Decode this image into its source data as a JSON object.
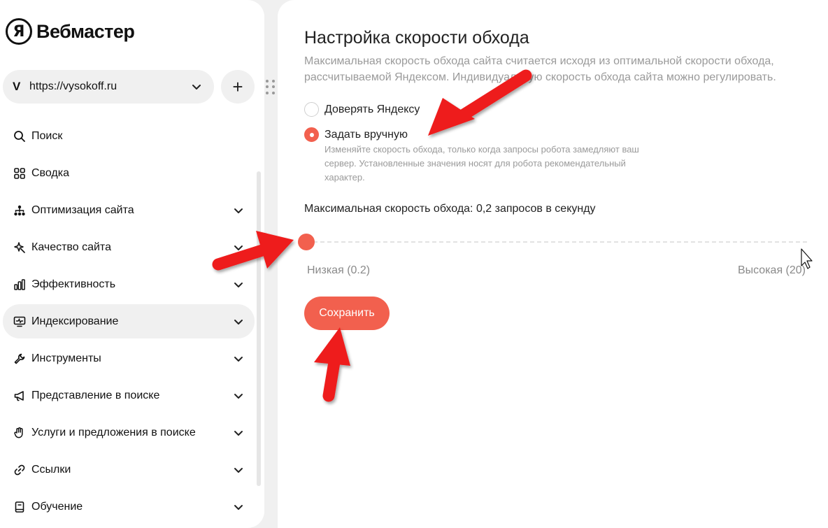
{
  "app": {
    "logo_mark": "Я",
    "title": "Вебмастер"
  },
  "site": {
    "favicon_letter": "V",
    "url": "https://vysokoff.ru",
    "add_label": "+"
  },
  "sidebar": {
    "items": [
      {
        "label": "Поиск",
        "icon": "search-icon",
        "chevron": false,
        "active": false
      },
      {
        "label": "Сводка",
        "icon": "grid-icon",
        "chevron": false,
        "active": false
      },
      {
        "label": "Оптимизация сайта",
        "icon": "sitemap-icon",
        "chevron": true,
        "active": false
      },
      {
        "label": "Качество сайта",
        "icon": "sparkle-icon",
        "chevron": true,
        "active": false
      },
      {
        "label": "Эффективность",
        "icon": "bar-chart-icon",
        "chevron": true,
        "active": false
      },
      {
        "label": "Индексирование",
        "icon": "monitor-icon",
        "chevron": true,
        "active": true
      },
      {
        "label": "Инструменты",
        "icon": "wrench-icon",
        "chevron": true,
        "active": false
      },
      {
        "label": "Представление в поиске",
        "icon": "megaphone-icon",
        "chevron": true,
        "active": false
      },
      {
        "label": "Услуги и предложения в поиске",
        "icon": "hand-icon",
        "chevron": true,
        "active": false
      },
      {
        "label": "Ссылки",
        "icon": "link-icon",
        "chevron": true,
        "active": false
      },
      {
        "label": "Обучение",
        "icon": "book-icon",
        "chevron": true,
        "active": false
      }
    ]
  },
  "main": {
    "title": "Настройка скорости обхода",
    "description": "Максимальная скорость обхода сайта считается исходя из оптимальной скорости обхода, рассчитываемой Яндексом. Индивидуальную скорость обхода сайта можно регулировать.",
    "options": [
      {
        "label": "Доверять Яндексу",
        "checked": false
      },
      {
        "label": "Задать вручную",
        "checked": true
      }
    ],
    "manual_hint": "Изменяйте скорость обхода, только когда запросы робота замедляют ваш сервер. Установленные значения носят для робота рекомендательный характер.",
    "speed_label": "Максимальная скорость обхода: 0,2 запросов в секунду",
    "slider": {
      "min_label": "Низкая (0.2)",
      "max_label": "Высокая (20)",
      "min": 0.2,
      "max": 20,
      "value": 0.2
    },
    "save_label": "Сохранить"
  },
  "colors": {
    "accent": "#f2604e",
    "annotation_arrow": "#ee1c1c",
    "background": "#f0f0f0"
  }
}
